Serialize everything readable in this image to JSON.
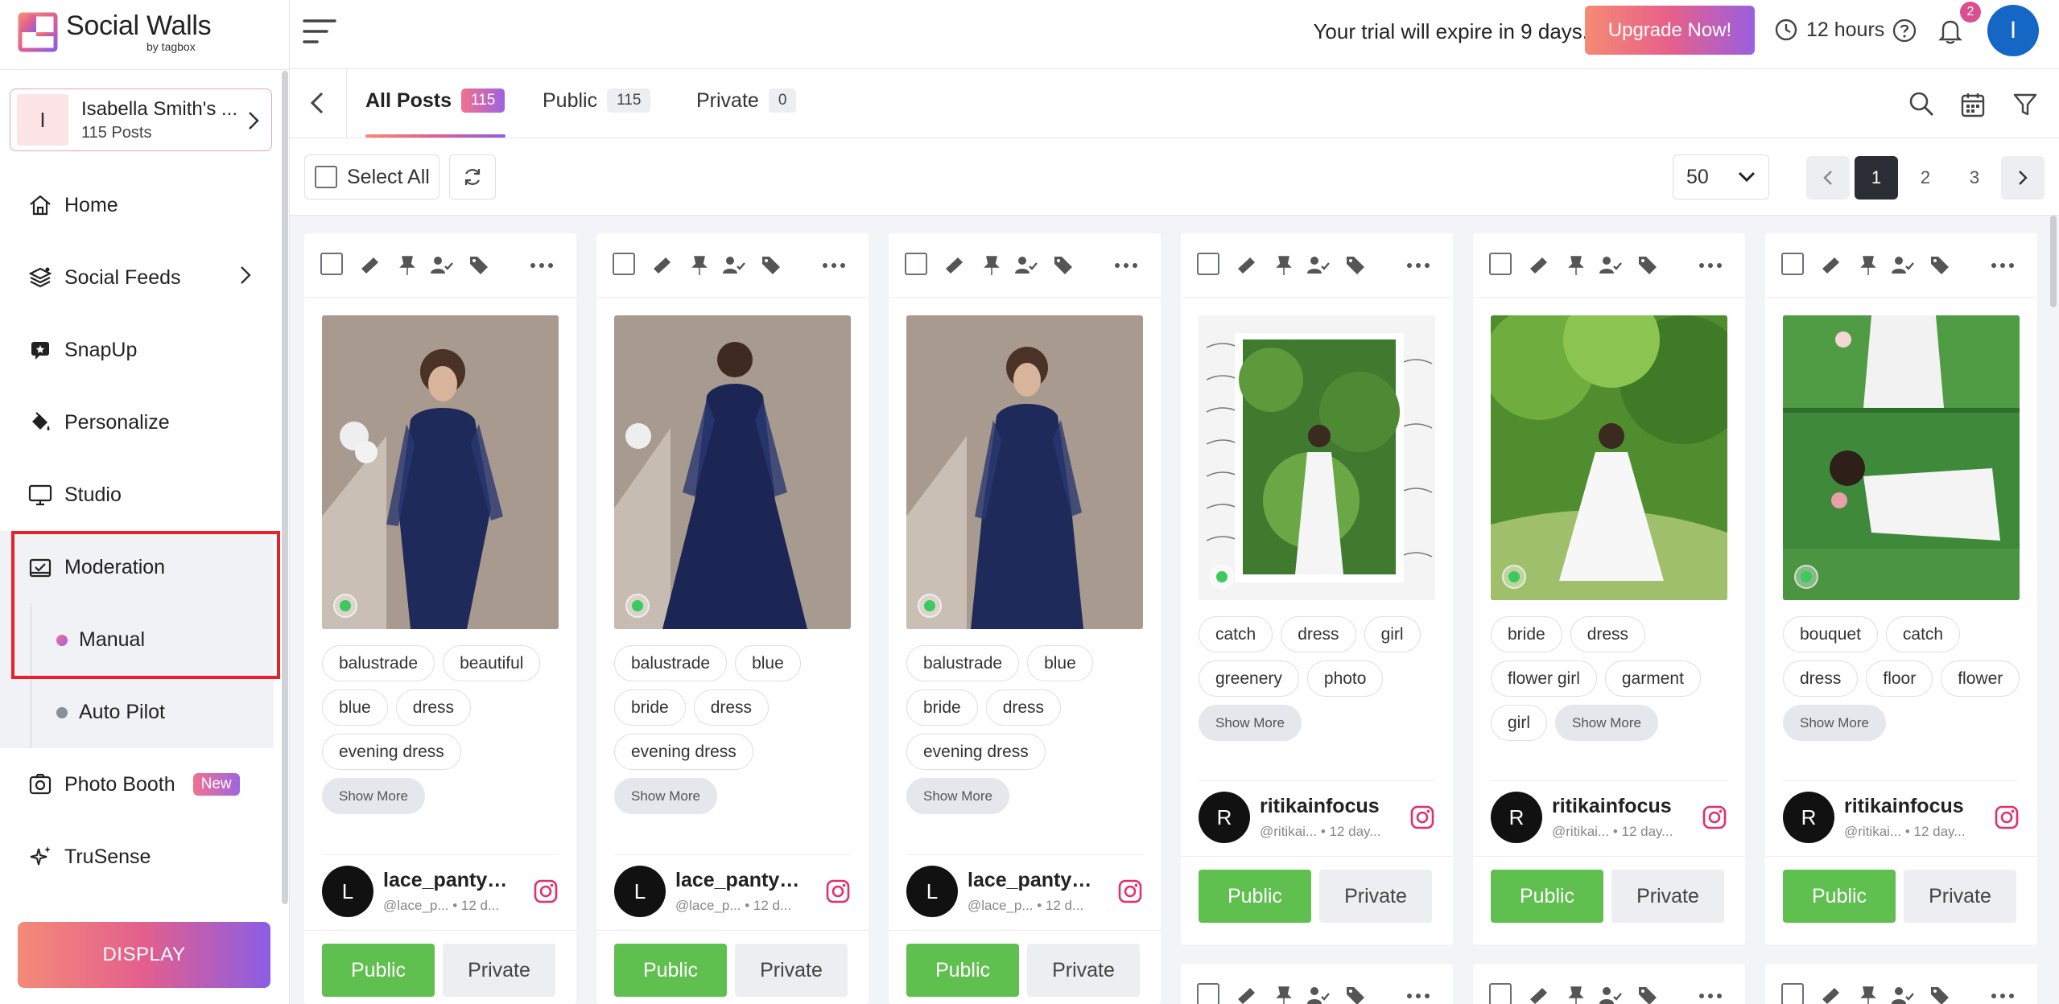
{
  "app": {
    "title": "Social Walls",
    "subtitle": "by tagbox"
  },
  "colors": {
    "accent_gradient_start": "#f58a73",
    "accent_gradient_end": "#8b5de5",
    "public_green": "#5fbf4f",
    "highlight_red": "#e8202a",
    "avatar_blue": "#1467c4"
  },
  "account": {
    "initial": "I",
    "name": "Isabella Smith's ...",
    "posts": "115 Posts"
  },
  "sidebar": {
    "items": [
      {
        "label": "Home",
        "icon": "home-icon"
      },
      {
        "label": "Social Feeds",
        "icon": "layers-icon"
      },
      {
        "label": "SnapUp",
        "icon": "snapup-icon"
      },
      {
        "label": "Personalize",
        "icon": "paint-bucket-icon"
      },
      {
        "label": "Studio",
        "icon": "monitor-icon"
      },
      {
        "label": "Moderation",
        "icon": "moderation-icon"
      },
      {
        "label": "Manual"
      },
      {
        "label": "Auto Pilot"
      },
      {
        "label": "Photo Booth",
        "icon": "camera-icon",
        "badge": "New"
      },
      {
        "label": "TruSense",
        "icon": "sparkle-icon"
      }
    ],
    "display_label": "DISPLAY"
  },
  "header": {
    "trial_text": "Your trial will expire in 9 days.",
    "upgrade_label": "Upgrade Now!",
    "hours": "12 hours",
    "notification_count": "2",
    "user_initial": "I"
  },
  "tabs": [
    {
      "label": "All Posts",
      "count": "115"
    },
    {
      "label": "Public",
      "count": "115"
    },
    {
      "label": "Private",
      "count": "0"
    }
  ],
  "toolbar": {
    "select_all": "Select All",
    "per_page": "50",
    "pages": [
      "1",
      "2",
      "3"
    ]
  },
  "cards": [
    {
      "tags": [
        "balustrade",
        "beautiful",
        "blue",
        "dress",
        "evening dress"
      ],
      "show_more": "Show More",
      "author_initial": "L",
      "author_name": "lace_panty_...",
      "author_meta": "@lace_p... • 12 d...",
      "public_label": "Public",
      "private_label": "Private"
    },
    {
      "tags": [
        "balustrade",
        "blue",
        "bride",
        "dress",
        "evening dress"
      ],
      "show_more": "Show More",
      "author_initial": "L",
      "author_name": "lace_panty_...",
      "author_meta": "@lace_p... • 12 d...",
      "public_label": "Public",
      "private_label": "Private"
    },
    {
      "tags": [
        "balustrade",
        "blue",
        "bride",
        "dress",
        "evening dress"
      ],
      "show_more": "Show More",
      "author_initial": "L",
      "author_name": "lace_panty_...",
      "author_meta": "@lace_p... • 12 d...",
      "public_label": "Public",
      "private_label": "Private"
    },
    {
      "tags": [
        "catch",
        "dress",
        "girl",
        "greenery",
        "photo"
      ],
      "show_more": "Show More",
      "author_initial": "R",
      "author_name": "ritikainfocus",
      "author_meta": "@ritikai... • 12 day...",
      "public_label": "Public",
      "private_label": "Private"
    },
    {
      "tags": [
        "bride",
        "dress",
        "flower girl",
        "garment",
        "girl"
      ],
      "show_more": "Show More",
      "author_initial": "R",
      "author_name": "ritikainfocus",
      "author_meta": "@ritikai... • 12 day...",
      "public_label": "Public",
      "private_label": "Private"
    },
    {
      "tags": [
        "bouquet",
        "catch",
        "dress",
        "floor",
        "flower"
      ],
      "show_more": "Show More",
      "author_initial": "R",
      "author_name": "ritikainfocus",
      "author_meta": "@ritikai... • 12 day...",
      "public_label": "Public",
      "private_label": "Private"
    }
  ]
}
